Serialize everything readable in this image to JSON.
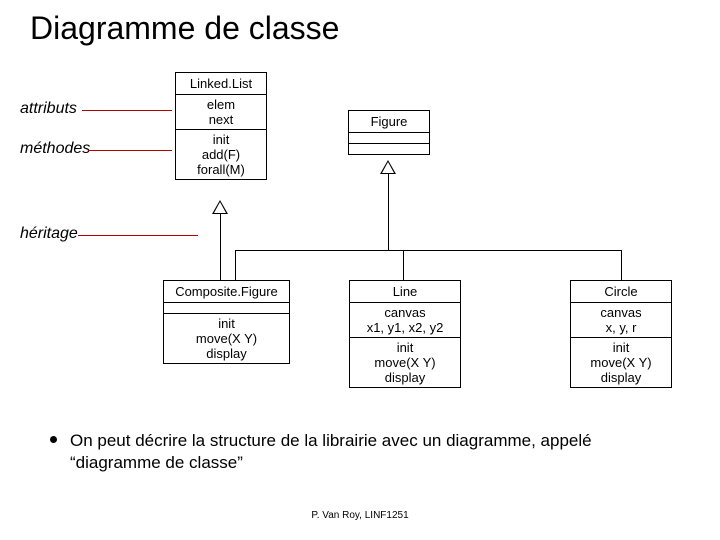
{
  "title": "Diagramme de classe",
  "labels": {
    "attributs": "attributs",
    "methodes": "méthodes",
    "heritage": "héritage"
  },
  "uml": {
    "linkedlist": {
      "name": "Linked.List",
      "attrs": "elem\nnext",
      "methods": "init\nadd(F)\nforall(M)"
    },
    "figure": {
      "name": "Figure"
    },
    "composite": {
      "name": "Composite.Figure",
      "attrs": "",
      "methods": "init\nmove(X Y)\ndisplay"
    },
    "lineClass": {
      "name": "Line",
      "attrs": "canvas\nx1, y1, x2, y2",
      "methods": "init\nmove(X Y)\ndisplay"
    },
    "circle": {
      "name": "Circle",
      "attrs": "canvas\nx, y, r",
      "methods": "init\nmove(X Y)\ndisplay"
    }
  },
  "bullet": "On peut décrire la structure de la librairie avec un diagramme, appelé “diagramme de classe”",
  "footer": "P. Van Roy, LINF1251"
}
